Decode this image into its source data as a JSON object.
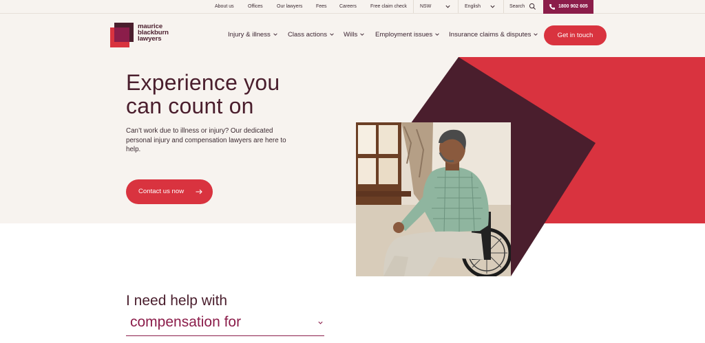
{
  "utility_bar": {
    "links": [
      "About us",
      "Offices",
      "Our lawyers",
      "Fees",
      "Careers",
      "Free claim check"
    ],
    "state_selector": "NSW",
    "language_selector": "English",
    "search_label": "Search",
    "phone": "1800 902 605"
  },
  "logo": {
    "lines": [
      "maurice",
      "blackburn",
      "lawyers"
    ]
  },
  "nav": {
    "items": [
      {
        "label": "Injury & illness"
      },
      {
        "label": "Class actions"
      },
      {
        "label": "Wills"
      },
      {
        "label": "Employment issues"
      },
      {
        "label": "Insurance claims & disputes"
      }
    ],
    "cta_label": "Get in touch"
  },
  "hero": {
    "title_line1": "Experience you",
    "title_line2": "can count on",
    "description": "Can’t work due to illness or injury? Our dedicated personal injury and compensation lawyers are here to help.",
    "button_label": "Contact us now"
  },
  "help": {
    "heading": "I need help with",
    "selected": "compensation for"
  },
  "colors": {
    "brand_red": "#d9333f",
    "brand_plum": "#4a1e2d",
    "brand_magenta": "#8b1d4a",
    "cream": "#f7f3ef"
  }
}
